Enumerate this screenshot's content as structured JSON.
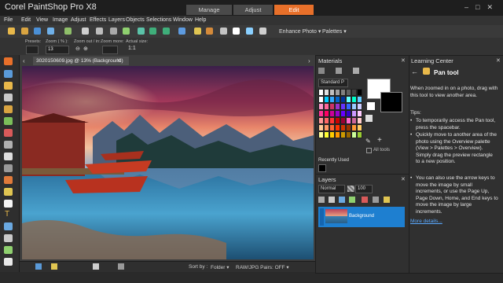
{
  "app": {
    "title": "Corel PaintShop Pro X8"
  },
  "modes": [
    {
      "label": "Manage"
    },
    {
      "label": "Adjust"
    },
    {
      "label": "Edit"
    }
  ],
  "menu": [
    "File",
    "Edit",
    "View",
    "Image",
    "Adjust",
    "Effects",
    "Layers",
    "Objects",
    "Selections",
    "Window",
    "Help"
  ],
  "toolbar": {
    "enhance_photo": "Enhance Photo ▾",
    "palettes": "Palettes ▾"
  },
  "tool_options": {
    "presets": "Presets:",
    "zoom_pct": "Zoom ( % ):",
    "zoom_value": "13",
    "zoom_out_in": "Zoom out / in:",
    "zoom_more": "Zoom more:",
    "actual_size": "Actual size:"
  },
  "document": {
    "tab_label": "3020150609.jpg @ 13% (Background)"
  },
  "materials": {
    "title": "Materials",
    "style_label": "Standard P",
    "all_tools": "All tools",
    "recently_used": "Recently Used",
    "swatch_colors": [
      "#ffffff",
      "#e0e0e0",
      "#c0c0c0",
      "#a0a0a0",
      "#808080",
      "#606060",
      "#404040",
      "#000000",
      "#ffffff",
      "#00ccff",
      "#33aaff",
      "#0066cc",
      "#003399",
      "#66ffff",
      "#00ffcc",
      "#66ccff",
      "#ff99cc",
      "#ff6699",
      "#cc3366",
      "#9933cc",
      "#6633ff",
      "#3366ff",
      "#99ccff",
      "#ccccff",
      "#ff3399",
      "#ff0066",
      "#cc0099",
      "#9900cc",
      "#6600ff",
      "#3300cc",
      "#cc99ff",
      "#ffccff",
      "#ff9999",
      "#ff6666",
      "#ff3333",
      "#cc0000",
      "#990033",
      "#ff66cc",
      "#cc6699",
      "#ffcccc",
      "#ffcc99",
      "#ff9966",
      "#ff6633",
      "#ff3300",
      "#cc3300",
      "#993300",
      "#ff9933",
      "#ffcc66",
      "#ffff99",
      "#ffff33",
      "#ffcc00",
      "#ff9900",
      "#cc9900",
      "#996600",
      "#ccff99",
      "#99cc33"
    ]
  },
  "layers": {
    "title": "Layers",
    "blend_mode": "Normal",
    "opacity": "100",
    "layer_name": "Background"
  },
  "learning_center": {
    "title": "Learning Center",
    "tool_name": "Pan tool",
    "intro": "When zoomed in on a photo, drag with this tool to view another area.",
    "tips_heading": "Tips:",
    "tips": [
      "To temporarily access the Pan tool, press the spacebar.",
      "Quickly move to another area of the photo using the Overview palette (View > Palettes > Overview). Simply drag the preview rectangle to a new position.",
      "You can also use the arrow keys to move the image by small increments, or use the Page Up, Page Down, Home, and End keys to move the image by large increments."
    ],
    "more_details": "More details..."
  },
  "bottom": {
    "sort_by": "Sort by :",
    "folder": "Folder ▾",
    "raw_pairs": "RAW/JPG Pairs: OFF ▾"
  },
  "colors": {
    "accent": "#e8702a",
    "selection": "#1e7fd0",
    "link": "#5aa9ff"
  }
}
